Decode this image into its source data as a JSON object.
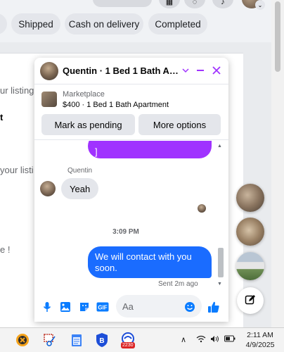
{
  "filter_chips": [
    "Shipped",
    "Cash on delivery",
    "Completed"
  ],
  "background_fragments": {
    "line1": "ur listing",
    "line2": "t",
    "line3": "your listi",
    "line4": "e !"
  },
  "chat": {
    "title": "Quentin · 1 Bed 1 Bath Apartment",
    "listing": {
      "source": "Marketplace",
      "title": "$400 · 1 Bed 1 Bath Apartment",
      "mark_pending_label": "Mark as pending",
      "more_options_label": "More options"
    },
    "messages": {
      "partial_outgoing": "]",
      "sender_name": "Quentin",
      "incoming": "Yeah",
      "timestamp": "3:09 PM",
      "outgoing": "We will contact with you soon.",
      "status": "Sent 2m ago"
    },
    "composer": {
      "placeholder": "Aa"
    },
    "colors": {
      "accent": "#a033ff",
      "outgoing_bubble": "#1a6cff",
      "purple_bubble": "#a032ff"
    }
  },
  "taskbar": {
    "time": "2:11 AM",
    "date": "4/9/2025",
    "badge": "2230"
  },
  "icons": [
    "search-icon",
    "messenger-icon",
    "notifications-icon",
    "minimize-icon",
    "close-icon",
    "chevron-down-icon",
    "mic-icon",
    "image-icon",
    "sticker-icon",
    "gif-icon",
    "emoji-icon",
    "like-icon",
    "compose-icon"
  ]
}
